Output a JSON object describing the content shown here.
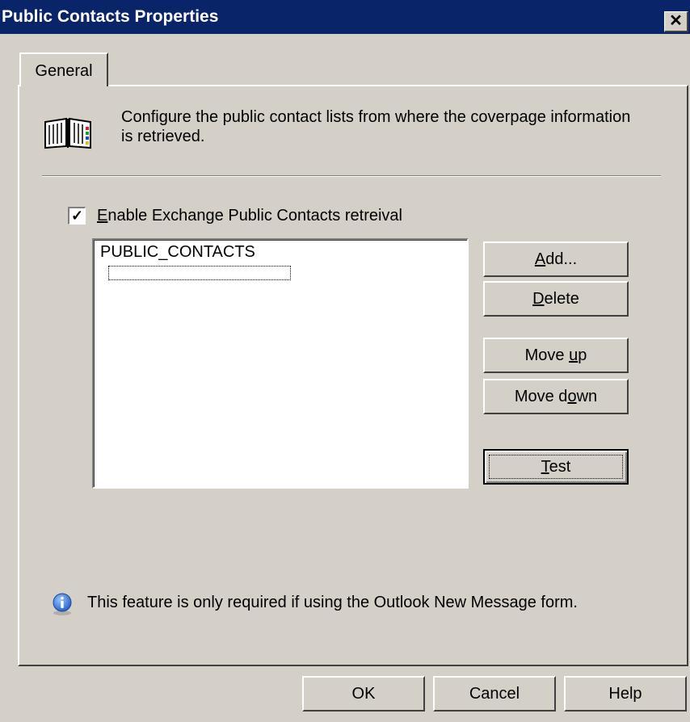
{
  "window": {
    "title": "Public Contacts Properties",
    "close_glyph": "✕"
  },
  "tabs": [
    {
      "label": "General"
    }
  ],
  "description": {
    "text": "Configure the public contact lists from where the coverpage information is retrieved.",
    "icon": "book-icon"
  },
  "enable_checkbox": {
    "checked": true,
    "check_glyph": "✓",
    "label_accel": "E",
    "label_rest": "nable Exchange Public Contacts retreival"
  },
  "list": {
    "items": [
      "PUBLIC_CONTACTS"
    ]
  },
  "buttons": {
    "add": {
      "pre": "",
      "accel": "A",
      "post": "dd..."
    },
    "delete": {
      "pre": "",
      "accel": "D",
      "post": "elete"
    },
    "move_up": {
      "pre": "Move ",
      "accel": "u",
      "post": "p"
    },
    "move_down": {
      "pre": "Move d",
      "accel": "o",
      "post": "wn"
    },
    "test": {
      "pre": "",
      "accel": "T",
      "post": "est"
    }
  },
  "note": {
    "text": "This feature is only required if using the Outlook New Message form.",
    "icon": "info-icon"
  },
  "footer": {
    "ok": "OK",
    "cancel": "Cancel",
    "help": "Help"
  },
  "colors": {
    "titlebar": "#0a246a",
    "face": "#d4d0c8",
    "info_blue": "#2a62c9"
  }
}
